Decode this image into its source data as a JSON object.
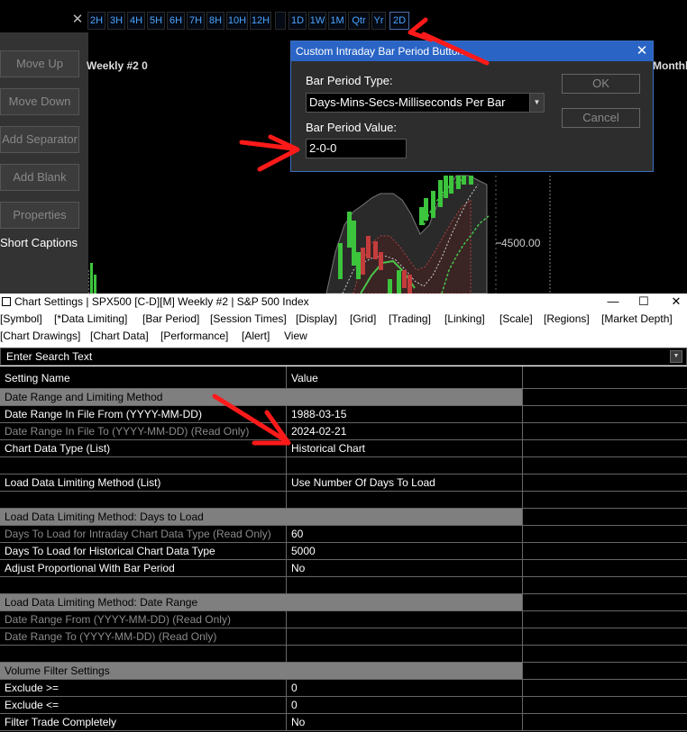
{
  "toolbar": {
    "close_glyph": "✕",
    "intraday_buttons": [
      "2H",
      "3H",
      "4H",
      "5H",
      "6H",
      "7H",
      "8H",
      "10H",
      "12H"
    ],
    "period_buttons": [
      "1D",
      "1W",
      "1M",
      "Qtr",
      "Yr",
      "2D"
    ]
  },
  "left_panel": {
    "buttons": [
      "Move Up",
      "Move Down",
      "Add Separator",
      "Add Blank",
      "Properties"
    ],
    "short_captions": "Short Captions"
  },
  "chart": {
    "title_left": "Weekly #2 0",
    "title_right": "Monthl",
    "price_level": "4500.00"
  },
  "dialog": {
    "title": "Custom Intraday Bar Period Button",
    "close_glyph": "✕",
    "period_type_label": "Bar Period Type:",
    "period_type_value": "Days-Mins-Secs-Milliseconds Per Bar",
    "period_value_label": "Bar Period Value:",
    "period_value": "2-0-0",
    "ok_label": "OK",
    "cancel_label": "Cancel"
  },
  "settings": {
    "title": "Chart Settings | SPX500 [C-D][M]  Weekly #2 | S&P 500 Index",
    "minimize_glyph": "—",
    "maximize_glyph": "☐",
    "close_glyph": "✕",
    "menu_row1": [
      "[Symbol]",
      "[*Data Limiting]",
      "[Bar Period]",
      "[Session Times]",
      "[Display]",
      "[Grid]",
      "[Trading]",
      "[Linking]",
      "[Scale]",
      "[Regions]",
      "[Market Depth]"
    ],
    "menu_row2": [
      "[Chart Drawings]",
      "[Chart Data]",
      "[Performance]",
      "[Alert]",
      "View"
    ],
    "search_placeholder": "Enter Search Text",
    "header": {
      "name": "Setting Name",
      "value": "Value"
    },
    "rows": [
      {
        "kind": "section",
        "name": "Date Range and Limiting Method",
        "value": ""
      },
      {
        "kind": "setting",
        "name": "Date Range In File From (YYYY-MM-DD)",
        "value": "1988-03-15"
      },
      {
        "kind": "readonly",
        "name": "Date Range In File To (YYYY-MM-DD) (Read Only)",
        "value": "2024-02-21"
      },
      {
        "kind": "setting",
        "name": "Chart Data Type (List)",
        "value": "Historical Chart"
      },
      {
        "kind": "blank",
        "name": "",
        "value": ""
      },
      {
        "kind": "setting",
        "name": "Load Data Limiting Method (List)",
        "value": "Use Number Of Days To Load"
      },
      {
        "kind": "blank",
        "name": "",
        "value": ""
      },
      {
        "kind": "section",
        "name": "Load Data Limiting Method: Days to Load",
        "value": ""
      },
      {
        "kind": "readonly",
        "name": "Days To Load for Intraday Chart Data Type (Read Only)",
        "value": "60"
      },
      {
        "kind": "setting",
        "name": "Days To Load for Historical Chart Data Type",
        "value": "5000"
      },
      {
        "kind": "setting",
        "name": "Adjust Proportional With Bar Period",
        "value": "No"
      },
      {
        "kind": "blank",
        "name": "",
        "value": ""
      },
      {
        "kind": "section",
        "name": "Load Data Limiting Method: Date Range",
        "value": ""
      },
      {
        "kind": "readonly",
        "name": "Date Range From (YYYY-MM-DD) (Read Only)",
        "value": ""
      },
      {
        "kind": "readonly",
        "name": "Date Range To (YYYY-MM-DD) (Read Only)",
        "value": ""
      },
      {
        "kind": "blank",
        "name": "",
        "value": ""
      },
      {
        "kind": "section",
        "name": "Volume Filter Settings",
        "value": ""
      },
      {
        "kind": "setting",
        "name": "Exclude >=",
        "value": "0"
      },
      {
        "kind": "setting",
        "name": "Exclude <=",
        "value": "0"
      },
      {
        "kind": "setting",
        "name": "Filter Trade Completely",
        "value": "No"
      }
    ]
  },
  "colors": {
    "accent_blue": "#2a64c5",
    "button_text_blue": "#4aa4ff",
    "annotation_red": "#ff1a1a",
    "section_gray": "#7f7f7f",
    "up_bar_green": "#3cc43c",
    "down_bar_red": "#c43c3c"
  }
}
